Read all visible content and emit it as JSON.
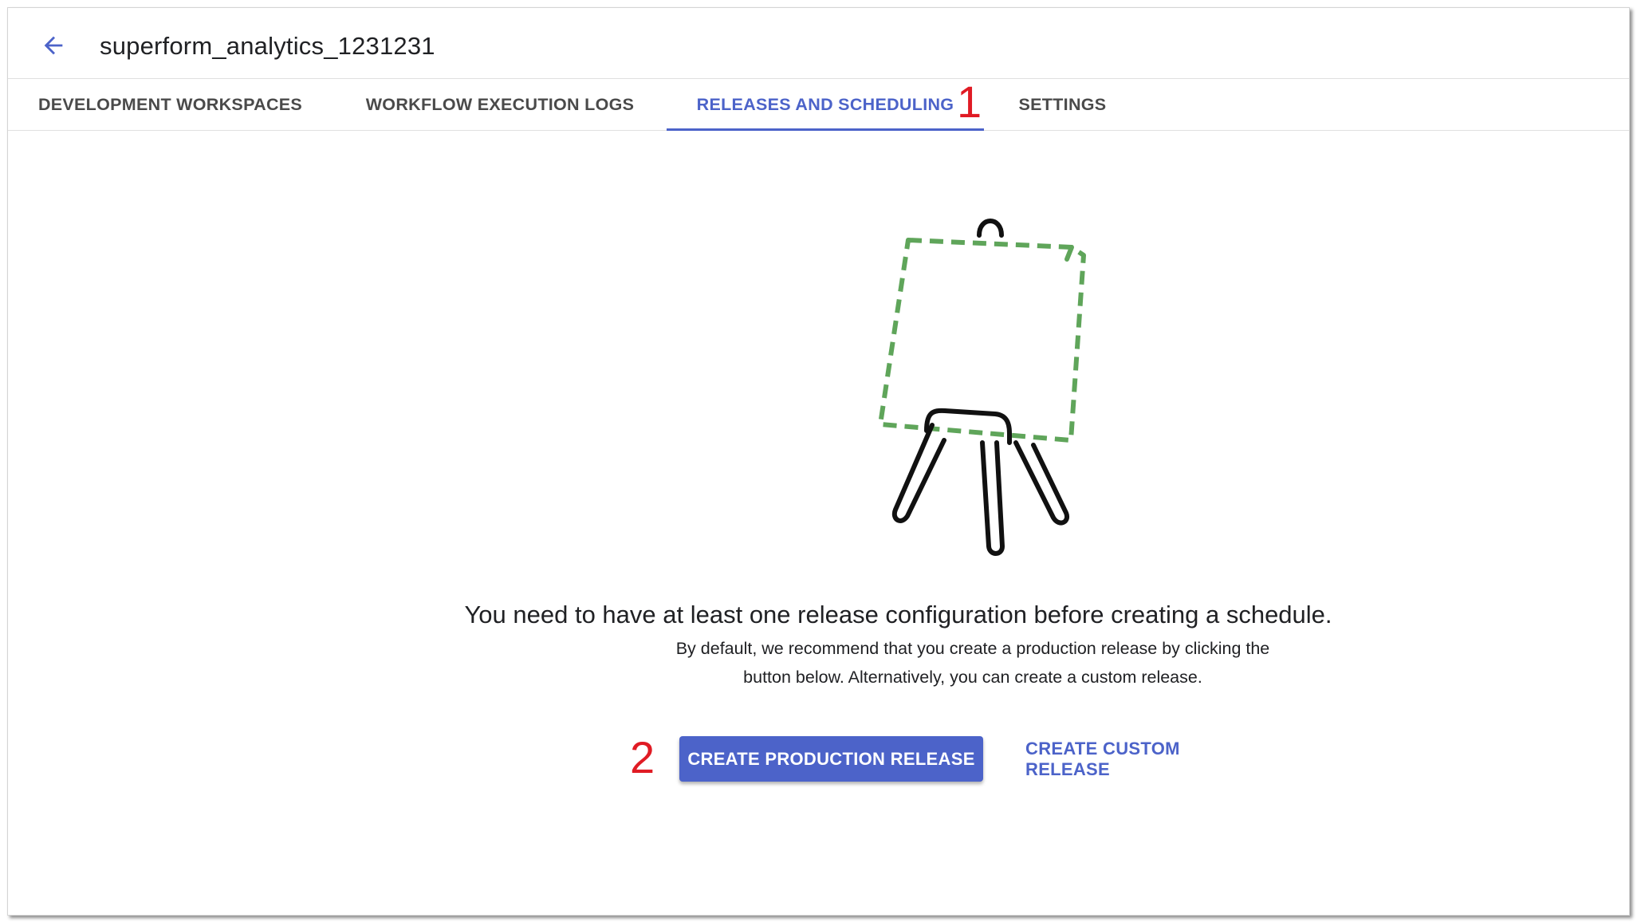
{
  "header": {
    "back_icon": "arrow-left-icon",
    "title": "superform_analytics_1231231"
  },
  "tabs": [
    {
      "label": "DEVELOPMENT WORKSPACES",
      "active": false
    },
    {
      "label": "WORKFLOW EXECUTION LOGS",
      "active": false
    },
    {
      "label": "RELEASES AND SCHEDULING",
      "active": true
    },
    {
      "label": "SETTINGS",
      "active": false
    }
  ],
  "annotations": {
    "marker_1": "1",
    "marker_2": "2"
  },
  "empty_state": {
    "illustration_icon": "easel-icon",
    "heading": "You need to have at least one release configuration before creating a schedule.",
    "description_line1": "By default, we recommend that you create a production release by clicking the",
    "description_line2": "button below. Alternatively, you can create a custom release."
  },
  "actions": {
    "primary_label": "CREATE PRODUCTION RELEASE",
    "secondary_label": "CREATE CUSTOM RELEASE"
  },
  "colors": {
    "accent": "#4c63c9",
    "annotation": "#e01b24",
    "dashed_frame": "#5fa55a"
  }
}
